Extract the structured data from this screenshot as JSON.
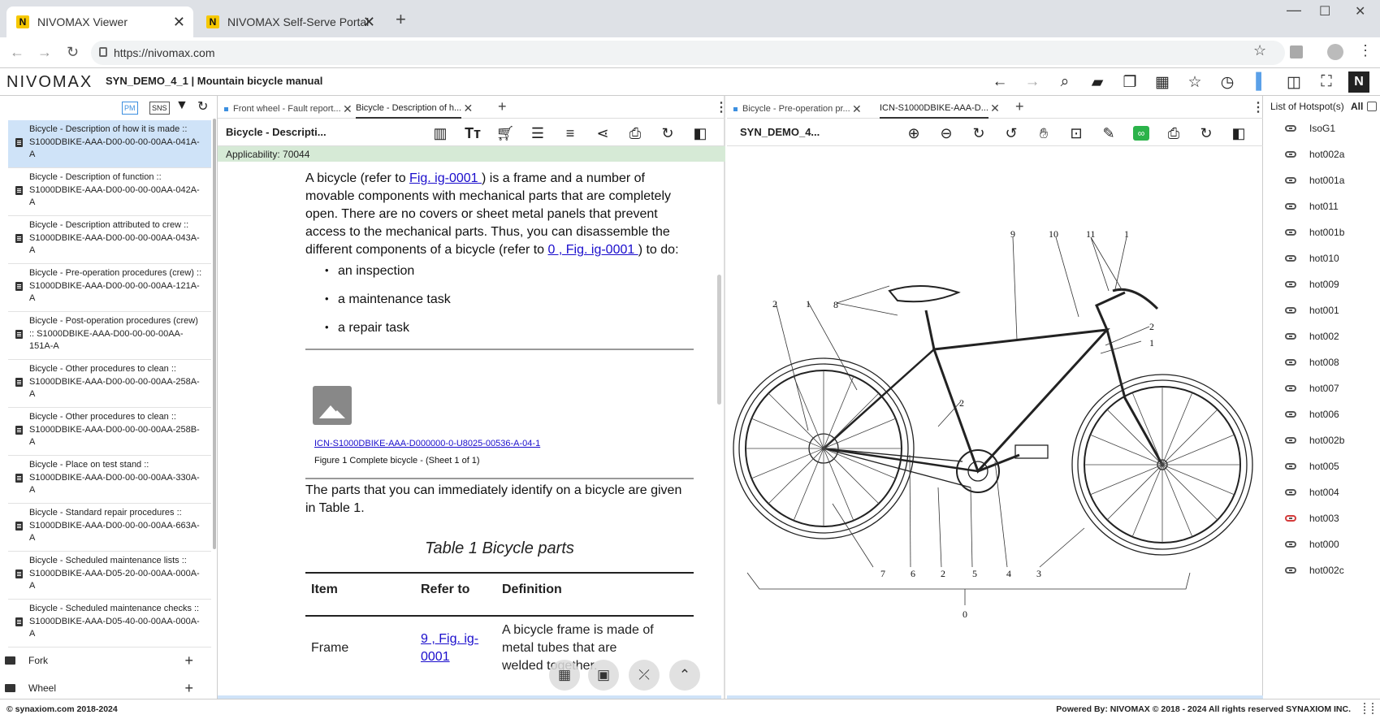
{
  "browser": {
    "tabs": [
      {
        "label": "NIVOMAX Viewer",
        "favicon": "N",
        "active": true
      },
      {
        "label": "NIVOMAX Self-Serve Portal",
        "favicon": "N",
        "active": false
      }
    ],
    "url": "https://nivomax.com"
  },
  "app": {
    "logo": "NIVOMAX",
    "title": "SYN_DEMO_4_1 | Mountain bicycle manual"
  },
  "sidebar": {
    "tools": {
      "pm": "PM",
      "sns": "SNS"
    },
    "items": [
      {
        "title": "Bicycle - Description of how it is made ::",
        "code1": "S1000DBIKE-AAA-D00-00-00-00AA-041A-",
        "code2": "A",
        "selected": true
      },
      {
        "title": "Bicycle - Description of function ::",
        "code1": "S1000DBIKE-AAA-D00-00-00-00AA-042A-",
        "code2": "A",
        "selected": false
      },
      {
        "title": "Bicycle - Description attributed to crew ::",
        "code1": "S1000DBIKE-AAA-D00-00-00-00AA-043A-",
        "code2": "A",
        "selected": false
      },
      {
        "title": "Bicycle - Pre-operation procedures (crew) ::",
        "code1": "S1000DBIKE-AAA-D00-00-00-00AA-121A-",
        "code2": "A",
        "selected": false
      },
      {
        "title": "Bicycle - Post-operation procedures (crew)",
        "code1": ":: S1000DBIKE-AAA-D00-00-00-00AA-",
        "code2": "151A-A",
        "selected": false
      },
      {
        "title": "Bicycle - Other procedures to clean ::",
        "code1": "S1000DBIKE-AAA-D00-00-00-00AA-258A-",
        "code2": "A",
        "selected": false
      },
      {
        "title": "Bicycle - Other procedures to clean ::",
        "code1": "S1000DBIKE-AAA-D00-00-00-00AA-258B-",
        "code2": "A",
        "selected": false
      },
      {
        "title": "Bicycle - Place on test stand ::",
        "code1": "S1000DBIKE-AAA-D00-00-00-00AA-330A-",
        "code2": "A",
        "selected": false
      },
      {
        "title": "Bicycle - Standard repair procedures ::",
        "code1": "S1000DBIKE-AAA-D00-00-00-00AA-663A-",
        "code2": "A",
        "selected": false
      },
      {
        "title": "Bicycle - Scheduled maintenance lists ::",
        "code1": "S1000DBIKE-AAA-D05-20-00-00AA-000A-",
        "code2": "A",
        "selected": false
      },
      {
        "title": "Bicycle - Scheduled maintenance checks ::",
        "code1": "S1000DBIKE-AAA-D05-40-00-00AA-000A-",
        "code2": "A",
        "selected": false
      }
    ],
    "folders": [
      {
        "label": "Fork",
        "action": "+"
      },
      {
        "label": "Wheel",
        "action": "+"
      }
    ]
  },
  "center": {
    "tabs": [
      {
        "label": "Front wheel - Fault report...",
        "active": false
      },
      {
        "label": "Bicycle - Description of h...",
        "active": true
      }
    ],
    "doc_title": "Bicycle - Descripti...",
    "applicability": "Applicability: 70044",
    "para1": {
      "t1": "A bicycle (refer to ",
      "link1": "Fig. ig-0001 ",
      "t2": ") is a frame and a number of movable components with mechanical parts that are completely open. There are no covers or sheet metal panels that prevent access to the mechanical parts. Thus, you can disassemble the different components of a bicycle (refer to ",
      "link2": "0 , Fig. ig-0001 ",
      "t3": ") to do:"
    },
    "bullets": [
      "an inspection",
      "a maintenance task",
      "a repair task"
    ],
    "figure": {
      "icn": "ICN-S1000DBIKE-AAA-D000000-0-U8025-00536-A-04-1",
      "caption": "Figure 1 Complete bicycle - (Sheet 1 of 1)"
    },
    "para2": "The parts that you can immediately identify on a bicycle are given in Table 1.",
    "table": {
      "title": "Table 1 Bicycle parts",
      "headers": [
        "Item",
        "Refer to",
        "Definition"
      ],
      "rows": [
        {
          "item": "Frame",
          "refer": "9 , Fig. ig-0001",
          "definition": "A bicycle frame is made of metal tubes that are welded together."
        }
      ]
    }
  },
  "viewer": {
    "tabs": [
      {
        "label": "Bicycle - Pre-operation pr...",
        "active": false
      },
      {
        "label": "ICN-S1000DBIKE-AAA-D...",
        "active": true
      }
    ],
    "title": "SYN_DEMO_4...",
    "callouts": [
      "9",
      "10",
      "11",
      "1",
      "2",
      "1",
      "8",
      "2",
      "1",
      "2",
      "7",
      "6",
      "2",
      "5",
      "4",
      "3",
      "0"
    ]
  },
  "hotspots": {
    "header": "List of Hotspot(s)",
    "all_label": "All",
    "items": [
      {
        "label": "IsoG1",
        "color": "#555555"
      },
      {
        "label": "hot002a",
        "color": "#555555"
      },
      {
        "label": "hot001a",
        "color": "#555555"
      },
      {
        "label": "hot011",
        "color": "#555555"
      },
      {
        "label": "hot001b",
        "color": "#555555"
      },
      {
        "label": "hot010",
        "color": "#555555"
      },
      {
        "label": "hot009",
        "color": "#555555"
      },
      {
        "label": "hot001",
        "color": "#555555"
      },
      {
        "label": "hot002",
        "color": "#555555"
      },
      {
        "label": "hot008",
        "color": "#555555"
      },
      {
        "label": "hot007",
        "color": "#555555"
      },
      {
        "label": "hot006",
        "color": "#555555"
      },
      {
        "label": "hot002b",
        "color": "#555555"
      },
      {
        "label": "hot005",
        "color": "#555555"
      },
      {
        "label": "hot004",
        "color": "#555555"
      },
      {
        "label": "hot003",
        "color": "#d43b3b"
      },
      {
        "label": "hot000",
        "color": "#555555"
      },
      {
        "label": "hot002c",
        "color": "#555555"
      }
    ]
  },
  "footer": {
    "left": "© synaxiom.com 2018-2024",
    "right": "Powered By: NIVOMAX © 2018 - 2024 All rights reserved SYNAXIOM INC."
  }
}
